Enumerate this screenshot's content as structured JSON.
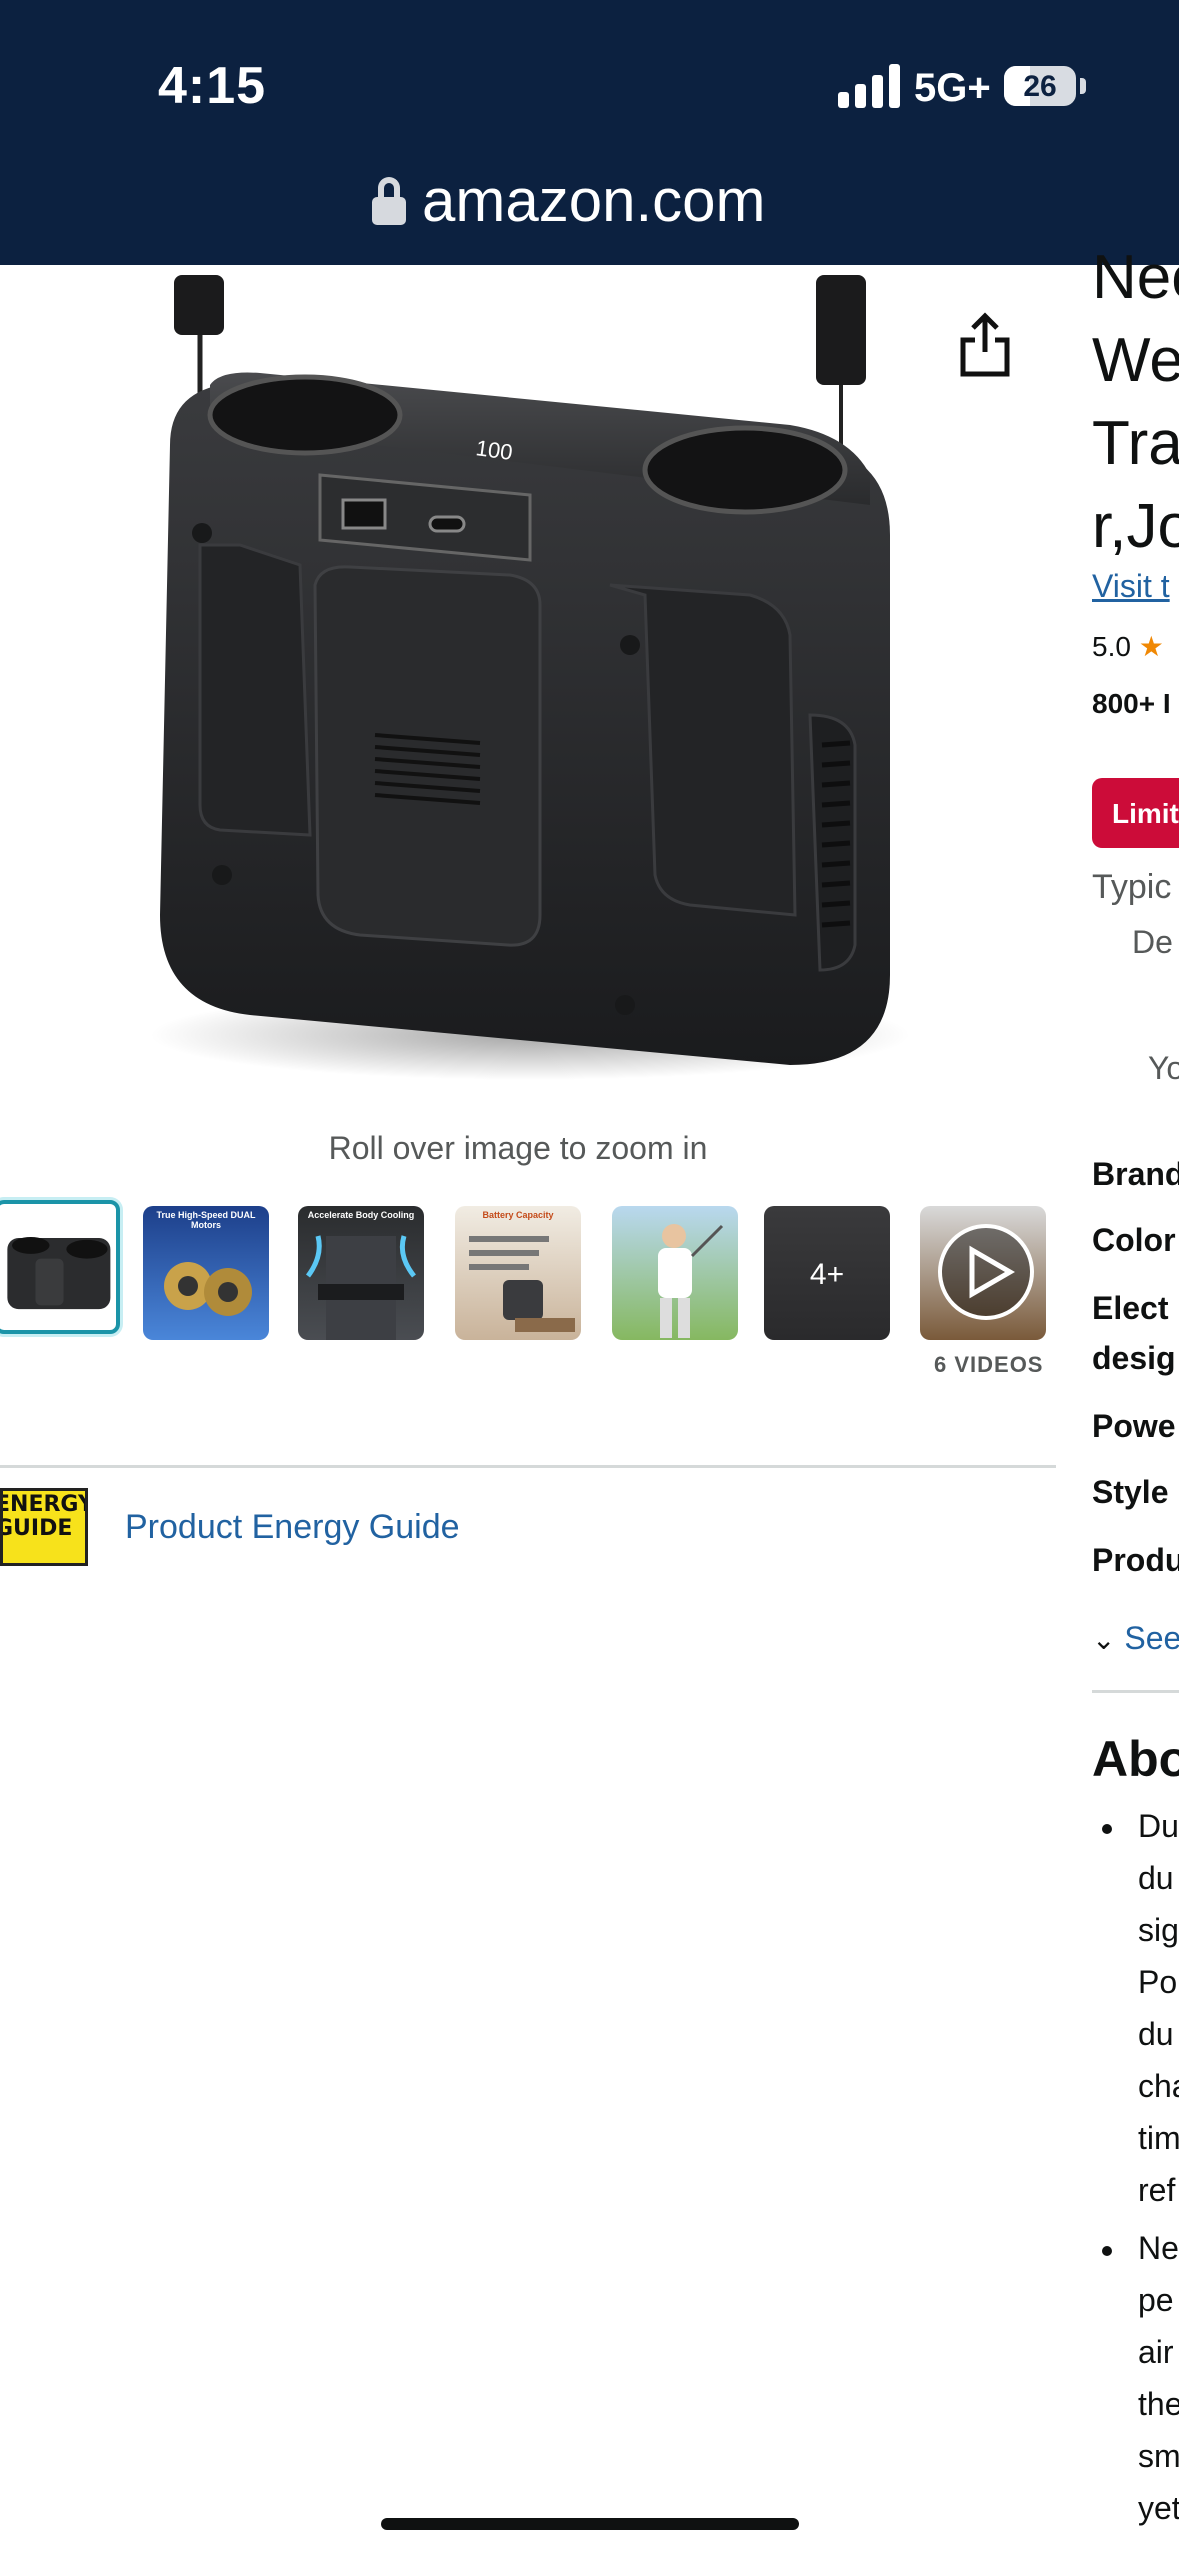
{
  "status_bar": {
    "time": "4:15",
    "network": "5G+",
    "battery": "26",
    "battery_level": 0.26
  },
  "browser": {
    "url": "amazon.com"
  },
  "gallery": {
    "zoom_hint": "Roll over image to zoom in",
    "videos_label": "6 VIDEOS",
    "thumbnails": [
      {
        "label": ""
      },
      {
        "label": "True High-Speed DUAL Motors"
      },
      {
        "label": "Accelerate Body Cooling"
      },
      {
        "label": "Battery Capacity"
      },
      {
        "label": ""
      },
      {
        "label": "4+"
      },
      {
        "label": ""
      }
    ]
  },
  "energy": {
    "badge_text": "ENERGY GUIDE",
    "link_label": "Product Energy Guide"
  },
  "right_column": {
    "title_lines": [
      "Nec",
      "We",
      "Tra",
      "r,Jo"
    ],
    "visit_store": "Visit t",
    "rating_value": "5.0",
    "bought": "800+ I",
    "deal_badge": "Limit",
    "typical": "Typic",
    "de": "De",
    "yo": "Yo",
    "specs": [
      "Brand",
      "Color",
      "Elect",
      "desig",
      "Powe",
      "Style",
      "Produ"
    ],
    "see_more": "See",
    "about_heading": "Abo",
    "bullets": [
      [
        "Du",
        "du",
        "sig",
        "Po",
        "du",
        "cha",
        "tim",
        "ref"
      ],
      [
        "Ne",
        "pe",
        "air",
        "the",
        "sm",
        "yet"
      ]
    ]
  }
}
